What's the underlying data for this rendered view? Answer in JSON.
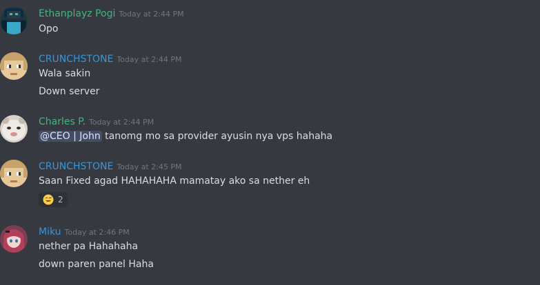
{
  "colors": {
    "background": "#36393f",
    "ethan": "#43b581",
    "crunch": "#3498db",
    "charles": "#43b581",
    "miku": "#3498db"
  },
  "messages": [
    {
      "author": "Ethanplayz Pogi",
      "time": "Today at 2:44 PM",
      "lines": [
        "Opo"
      ]
    },
    {
      "author": "CRUNCHSTONE",
      "time": "Today at 2:44 PM",
      "lines": [
        "Wala sakin",
        "Down server"
      ]
    },
    {
      "author": "Charles P.",
      "time": "Today at 2:44 PM",
      "mention": "@CEO | John",
      "lines": [
        " tanomg mo sa provider ayusin nya vps hahaha"
      ]
    },
    {
      "author": "CRUNCHSTONE",
      "time": "Today at 2:45 PM",
      "lines": [
        "Saan Fixed agad HAHAHAHA mamatay ako sa nether eh"
      ],
      "reaction": {
        "icon": "grinning-sweat-emoji-icon",
        "count": "2"
      }
    },
    {
      "author": "Miku",
      "time": "Today at 2:46 PM",
      "lines": [
        "nether pa Hahahaha",
        "down paren panel Haha"
      ]
    }
  ]
}
